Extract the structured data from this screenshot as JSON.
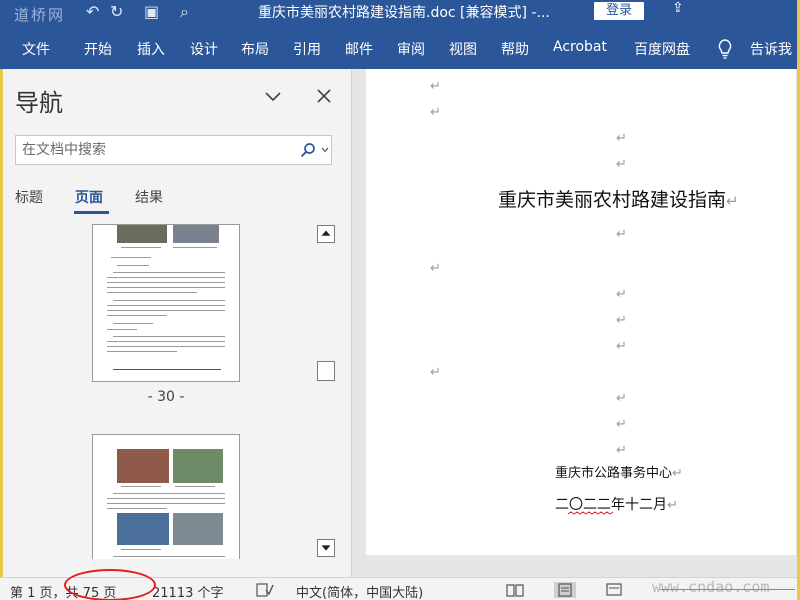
{
  "titlebar": {
    "watermark": "道桥网",
    "doc_title": "重庆市美丽农村路建设指南.doc [兼容模式] -...",
    "login": "登录"
  },
  "ribbon": {
    "tabs": [
      "文件",
      "开始",
      "插入",
      "设计",
      "布局",
      "引用",
      "邮件",
      "审阅",
      "视图",
      "帮助",
      "Acrobat",
      "百度网盘",
      "告诉我"
    ]
  },
  "nav": {
    "title": "导航",
    "search_placeholder": "在文档中搜索",
    "tabs": [
      "标题",
      "页面",
      "结果"
    ],
    "active_tab": "页面",
    "pages": [
      {
        "label": "- 30 -"
      }
    ]
  },
  "document": {
    "title": "重庆市美丽农村路建设指南",
    "org": "重庆市公路事务中心",
    "date": "二〇二二年十二月",
    "pilcrow": "↵"
  },
  "status": {
    "page": "第 1 页，共 75 页",
    "words": "21113 个字",
    "language": "中文(简体，中国大陆)",
    "watermark": "www.cndao.com"
  },
  "colors": {
    "accent": "#2b579a",
    "annotation": "#e02020"
  }
}
